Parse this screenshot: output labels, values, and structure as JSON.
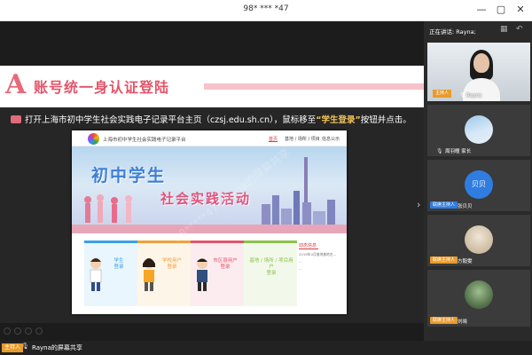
{
  "window": {
    "title": "98* *** *47",
    "minimize": "—",
    "maximize": "▢",
    "close": "✕"
  },
  "slide": {
    "logo_glyph": "A",
    "title": "账号统一身认证登陆",
    "instruction_pre": "打开上海市初中学生社会实践电子记录平台主页（czsj.edu.sh.cn），鼠标移至",
    "instruction_hl": "“学生登录”",
    "instruction_post": "按钮并点击。",
    "watermark": "98*****47 Rayna的屏幕共享"
  },
  "site": {
    "title": "上海市初中学生社会实践电子记录平台",
    "nav": [
      "首页",
      "基地 / 场所 / 项目",
      "信息公示"
    ],
    "banner_line1": "初中学生",
    "banner_line2": "社会实践活动",
    "cards": [
      {
        "label": "学生\n登录",
        "color": "#3aa0e8",
        "bg": "#eaf6fd"
      },
      {
        "label": "学校用户\n登录",
        "color": "#f0a23a",
        "bg": "#fdf5e8"
      },
      {
        "label": "市区县用户\n登录",
        "color": "#e2556b",
        "bg": "#fdecef"
      },
      {
        "label": "基地 / 场所 / 项目用户\n登录",
        "color": "#8cc24a",
        "bg": "#f2f9ea"
      }
    ],
    "news_header": "动态信息",
    "news_items": [
      "2019年4月基地基地名...",
      "...",
      "..."
    ]
  },
  "panel": {
    "speaking": "正在讲话: Rayna;",
    "participants": [
      {
        "name": "Rayna",
        "badge": "主持人",
        "type": "video"
      },
      {
        "name": "周羽瞳 家长",
        "badge": "",
        "type": "sky"
      },
      {
        "name": "张贝贝",
        "badge": "联席主持人",
        "type": "initials",
        "initials": "贝贝"
      },
      {
        "name": "方毅雯",
        "badge": "联席主持人",
        "type": "photo"
      },
      {
        "name": "刘晓",
        "badge": "联席主持人",
        "type": "photo2"
      }
    ]
  },
  "bottom": {
    "host_badge": "主持人",
    "share_label": "Rayna的屏幕共享"
  },
  "colors": {
    "accent": "#e3556a",
    "host_badge": "#e99b2c",
    "initials_avatar": "#2f7de1"
  }
}
